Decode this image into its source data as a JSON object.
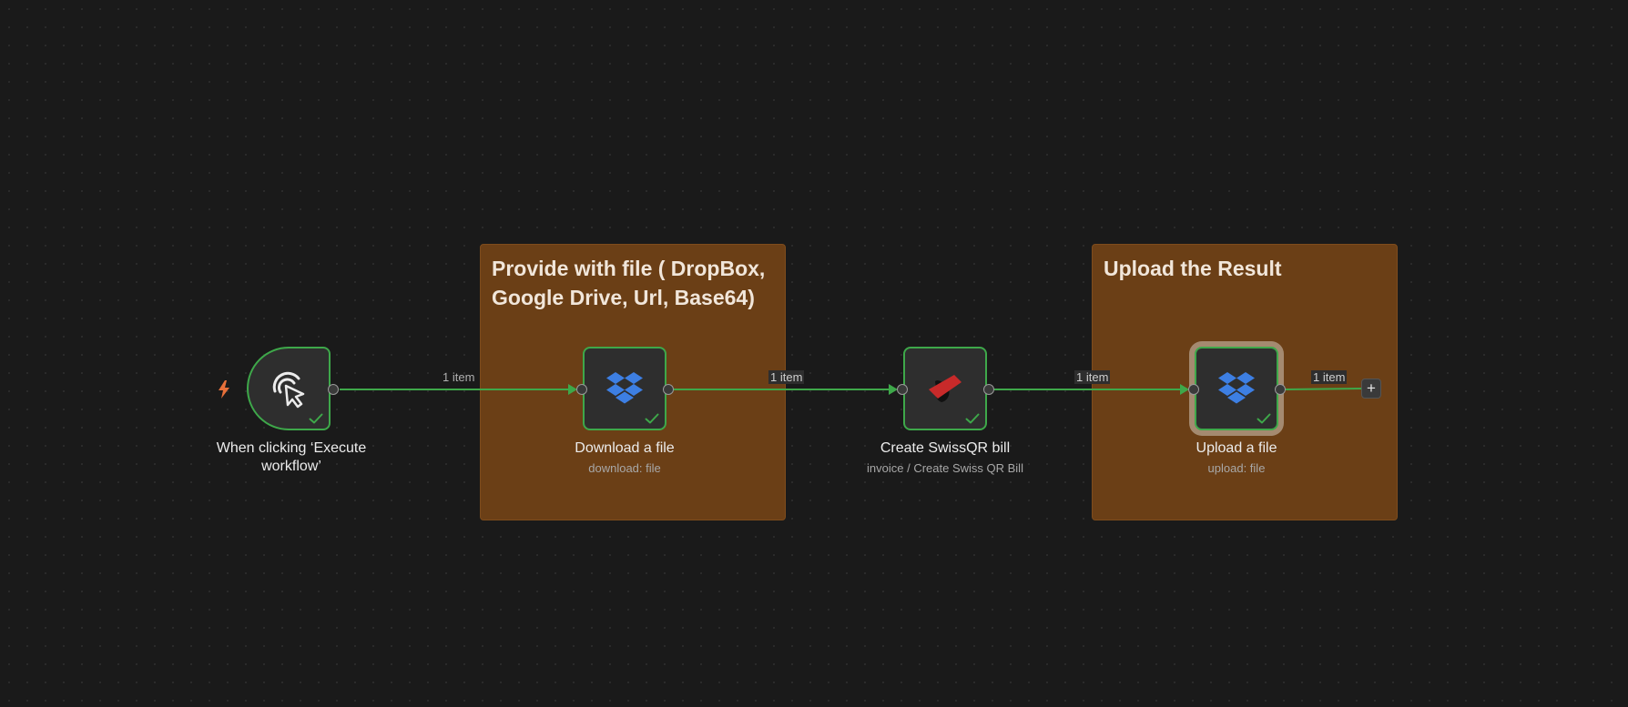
{
  "sticky_notes": [
    {
      "title": "Provide with file ( DropBox, Google Drive, Url, Base64)"
    },
    {
      "title": "Upload the Result"
    }
  ],
  "nodes": {
    "trigger": {
      "title": "When clicking ‘Execute workflow’",
      "icon": "cursor-click-icon"
    },
    "download": {
      "title": "Download a file",
      "subtitle": "download: file",
      "icon": "dropbox-icon"
    },
    "swissqr": {
      "title": "Create SwissQR bill",
      "subtitle": "invoice / Create Swiss QR Bill",
      "icon": "swissqr-icon"
    },
    "upload": {
      "title": "Upload a file",
      "subtitle": "upload: file",
      "icon": "dropbox-icon"
    }
  },
  "edges": [
    {
      "label": "1 item"
    },
    {
      "label": "1 item"
    },
    {
      "label": "1 item"
    },
    {
      "label": "1 item"
    }
  ],
  "add_button": {
    "label": "+"
  },
  "colors": {
    "success": "#3ea84a",
    "sticky": "#6b3f16",
    "dropbox": "#3d7fe3",
    "swissqr_red": "#c82a2a",
    "trigger_bolt": "#e8703a"
  }
}
